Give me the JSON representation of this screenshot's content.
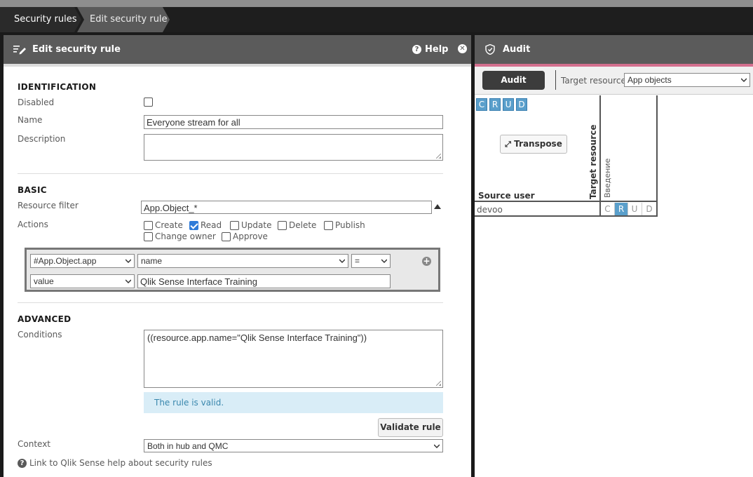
{
  "breadcrumb": {
    "items": [
      "Security rules",
      "Edit security rule"
    ]
  },
  "editor": {
    "title": "Edit security rule",
    "help_label": "Help",
    "identification": {
      "heading": "IDENTIFICATION",
      "disabled_label": "Disabled",
      "disabled_checked": false,
      "name_label": "Name",
      "name_value": "Everyone stream for all",
      "description_label": "Description",
      "description_value": ""
    },
    "basic": {
      "heading": "BASIC",
      "resource_filter_label": "Resource filter",
      "resource_filter_value": "App.Object_*",
      "actions_label": "Actions",
      "actions": [
        {
          "label": "Create",
          "checked": false
        },
        {
          "label": "Read",
          "checked": true
        },
        {
          "label": "Update",
          "checked": false
        },
        {
          "label": "Delete",
          "checked": false
        },
        {
          "label": "Publish",
          "checked": false
        },
        {
          "label": "Change owner",
          "checked": false
        },
        {
          "label": "Approve",
          "checked": false
        }
      ],
      "condition_builder": {
        "resource_select": "#App.Object.app",
        "property_select": "name",
        "operator_select": "=",
        "value_type_select": "value",
        "value_input": "Qlik Sense Interface Training"
      }
    },
    "advanced": {
      "heading": "ADVANCED",
      "conditions_label": "Conditions",
      "conditions_value": "((resource.app.name=\"Qlik Sense Interface Training\"))",
      "valid_message": "The rule is valid.",
      "validate_button": "Validate rule",
      "context_label": "Context",
      "context_value": "Both in hub and QMC",
      "help_link": "Link to Qlik Sense help about security rules"
    }
  },
  "audit": {
    "title": "Audit",
    "audit_button": "Audit",
    "target_resource_label": "Target resource",
    "target_resource_value": "App objects",
    "crud_buttons": [
      "C",
      "R",
      "U",
      "D"
    ],
    "transpose_button": "Transpose",
    "target_resource_axis_label": "Target resource",
    "column_header": "Введение",
    "source_user_label": "Source user",
    "rows": [
      {
        "user": "devoo",
        "cells": [
          "C",
          "R",
          "U",
          "D"
        ],
        "active": "R"
      }
    ]
  },
  "colors": {
    "accent_blue": "#5a9fcb",
    "header_gray": "#5b5b5b",
    "audit_accent": "#d36f8e",
    "valid_bg": "#d9edf7"
  }
}
